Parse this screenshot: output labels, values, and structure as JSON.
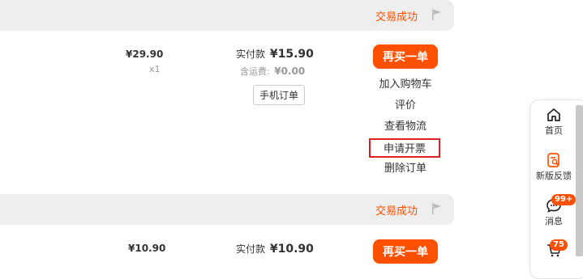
{
  "orders": [
    {
      "status": "交易成功",
      "price": "¥29.90",
      "quantity": "x1",
      "paid_label": "实付款",
      "paid_amount": "¥15.90",
      "shipping_label": "含运费:",
      "shipping_amount": "¥0.00",
      "mobile_order_tag": "手机订单",
      "rebuy_label": "再买一单",
      "actions": [
        "加入购物车",
        "评价",
        "查看物流",
        "申请开票",
        "删除订单"
      ]
    },
    {
      "status": "交易成功",
      "price": "¥10.90",
      "paid_label": "实付款",
      "paid_amount": "¥10.90",
      "rebuy_label": "再买一单"
    }
  ],
  "sidebar": {
    "items": [
      {
        "label": "首页",
        "icon": "home-icon"
      },
      {
        "label": "新版反馈",
        "icon": "feedback-icon"
      },
      {
        "label": "消息",
        "icon": "message-icon",
        "badge": "99+"
      },
      {
        "label": "",
        "icon": "cart-icon",
        "badge": "75"
      }
    ]
  },
  "colors": {
    "accent": "#ff5000",
    "highlight_border": "#e02020",
    "header_bg": "#eeeeee"
  }
}
